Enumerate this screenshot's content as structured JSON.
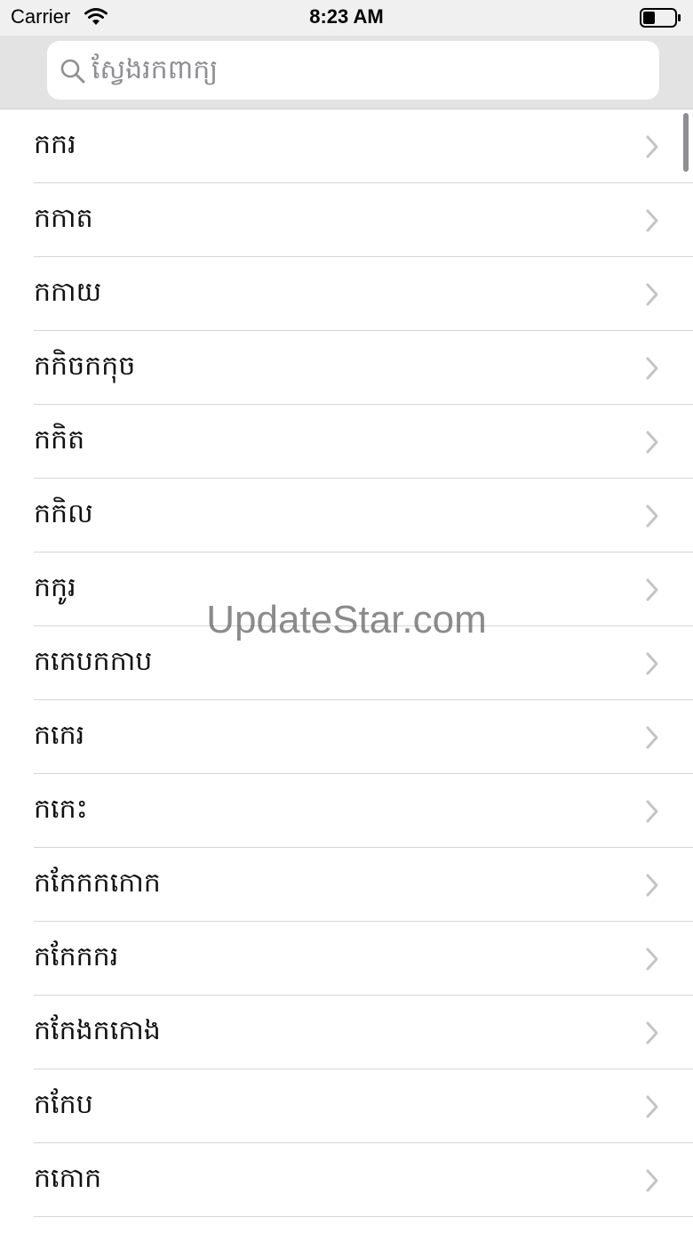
{
  "status_bar": {
    "carrier": "Carrier",
    "time": "8:23 AM",
    "wifi_icon": "wifi-icon",
    "battery_icon": "battery-icon"
  },
  "search": {
    "placeholder": "ស្វែងរកពាក្យ",
    "icon": "search-icon"
  },
  "list": {
    "items": [
      {
        "label": "កករ"
      },
      {
        "label": "កកាត"
      },
      {
        "label": "កកាយ"
      },
      {
        "label": "កកិចកកុច"
      },
      {
        "label": "កកិត"
      },
      {
        "label": "កកិល"
      },
      {
        "label": "កកូរ"
      },
      {
        "label": "កកេបកកាប"
      },
      {
        "label": "កកេរ"
      },
      {
        "label": "កកេះ"
      },
      {
        "label": "កកែកកកោក"
      },
      {
        "label": "កកែកករ"
      },
      {
        "label": "កកែងកកោង"
      },
      {
        "label": "កកែប"
      },
      {
        "label": "កកោក"
      }
    ],
    "chevron_icon": "chevron-right-icon"
  },
  "watermark": "UpdateStar.com",
  "colors": {
    "header_bg": "#e3e3e3",
    "separator": "#d6d6d6",
    "placeholder": "#8e8e93",
    "chevron": "#c4c4c7"
  }
}
